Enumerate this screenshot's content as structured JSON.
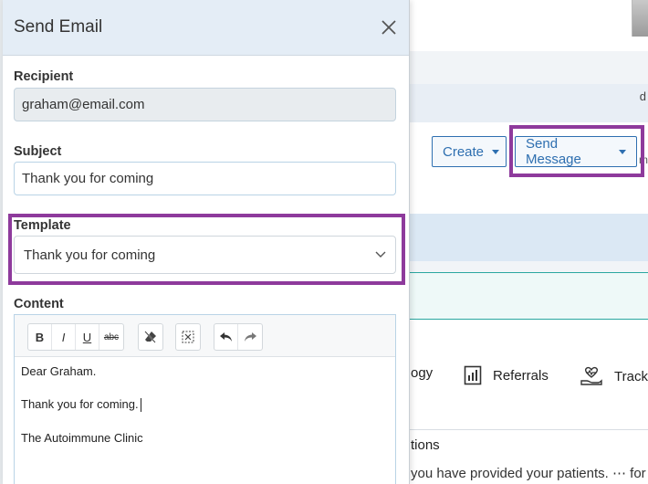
{
  "dialog": {
    "title": "Send Email",
    "recipient": {
      "label": "Recipient",
      "value": "graham@email.com"
    },
    "subject": {
      "label": "Subject",
      "value": "Thank you for coming"
    },
    "template": {
      "label": "Template",
      "selected": "Thank you for coming"
    },
    "content": {
      "label": "Content",
      "toolbar": [
        "bold",
        "italic",
        "underline",
        "strikethrough",
        "clear-format",
        "select-all",
        "undo",
        "redo"
      ],
      "toolbar_labels": {
        "bold": "B",
        "italic": "I",
        "underline": "U",
        "strike": "abc"
      },
      "lines": [
        "Dear Graham.",
        "Thank you for coming.",
        "The Autoimmune Clinic"
      ]
    }
  },
  "background": {
    "create_button": "Create",
    "send_message_button": "Send Message",
    "band_fragment": "d",
    "cut_text": "m",
    "tabs": [
      {
        "label": "ogy"
      },
      {
        "label": "Referrals",
        "icon": "referrals-chart-icon"
      },
      {
        "label": "Track",
        "icon": "heart-hand-icon"
      }
    ],
    "section_title": "tions",
    "section_text": "you have provided your patients.",
    "section_more": "⋯ for m"
  },
  "colors": {
    "accent": "#2e6fb0",
    "highlight": "#8e3a9c",
    "header_bg": "#e4edf6"
  }
}
